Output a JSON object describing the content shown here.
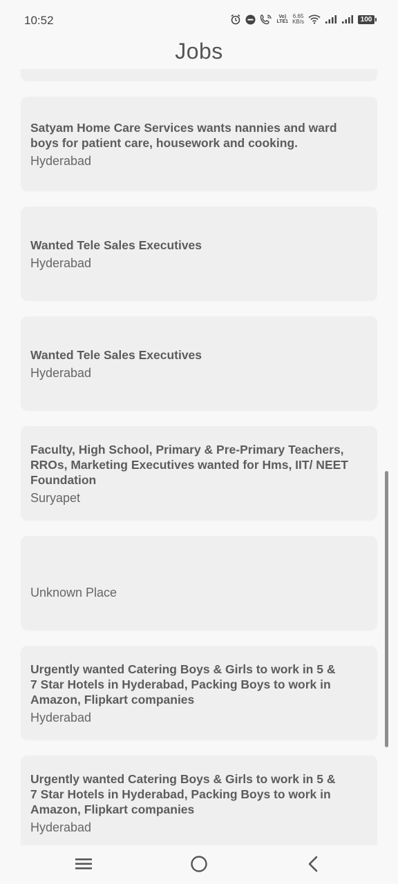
{
  "status_bar": {
    "time": "10:52",
    "volte_top": "Vo)",
    "volte_bottom": "LTE1",
    "speed_value": "6.65",
    "speed_unit": "KB/s",
    "battery": "100",
    "icons": [
      "alarm-icon",
      "dnd-icon",
      "call-wifi-icon",
      "wifi-icon",
      "signal-icon",
      "signal-icon",
      "battery-icon"
    ]
  },
  "header": {
    "title": "Jobs"
  },
  "jobs": [
    {
      "title": "",
      "place": ""
    },
    {
      "title": "Satyam Home Care Services wants nannies and ward boys for patient care, housework and cooking.",
      "place": "Hyderabad"
    },
    {
      "title": "Wanted Tele Sales Executives",
      "place": "Hyderabad"
    },
    {
      "title": "Wanted Tele Sales Executives",
      "place": "Hyderabad"
    },
    {
      "title": "Faculty, High School, Primary & Pre-Primary Teachers, RROs, Marketing Executives wanted for Hms, IIT/ NEET Foundation",
      "place": "Suryapet"
    },
    {
      "title": "",
      "place": "Unknown Place"
    },
    {
      "title": "Urgently wanted Catering Boys & Girls to work in 5 & 7 Star Hotels in Hyderabad, Packing Boys to work in Amazon, Flipkart companies",
      "place": "Hyderabad"
    },
    {
      "title": "Urgently wanted Catering Boys & Girls to work in 5 & 7 Star Hotels in Hyderabad, Packing Boys to work in Amazon, Flipkart companies",
      "place": "Hyderabad"
    }
  ],
  "nav": {
    "icons": [
      "menu-icon",
      "home-icon",
      "back-icon"
    ]
  }
}
